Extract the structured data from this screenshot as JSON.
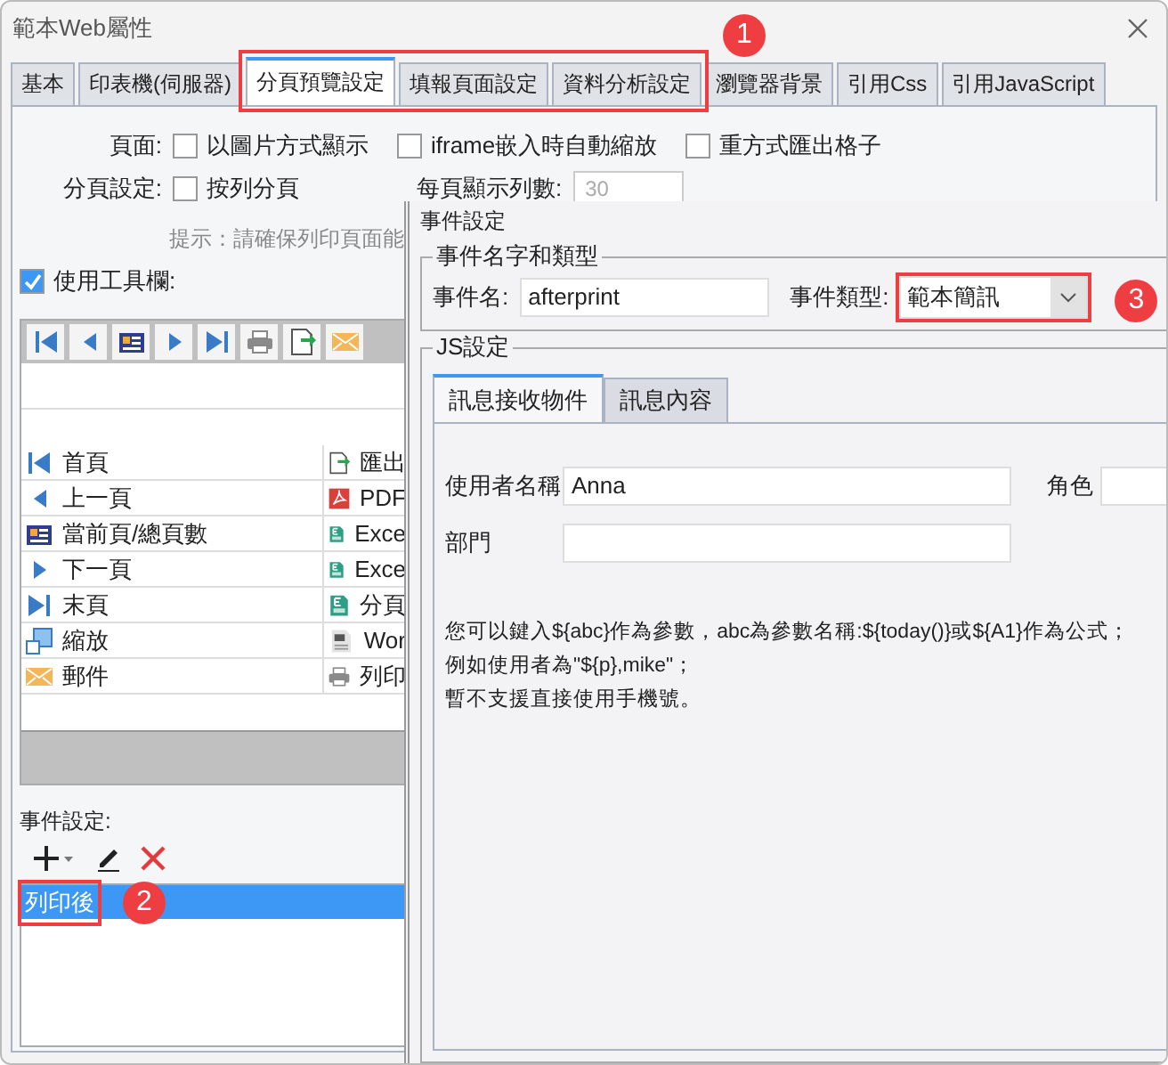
{
  "window": {
    "title": "範本Web屬性"
  },
  "tabs": [
    {
      "label": "基本",
      "selected": false
    },
    {
      "label": "印表機(伺服器)",
      "selected": false
    },
    {
      "label": "分頁預覽設定",
      "selected": true
    },
    {
      "label": "填報頁面設定",
      "selected": false
    },
    {
      "label": "資料分析設定",
      "selected": false
    },
    {
      "label": "瀏覽器背景",
      "selected": false
    },
    {
      "label": "引用Css",
      "selected": false
    },
    {
      "label": "引用JavaScript",
      "selected": false
    }
  ],
  "page_options": {
    "label": "頁面:",
    "checkboxes": [
      {
        "label": "以圖片方式顯示",
        "checked": false
      },
      {
        "label": "iframe嵌入時自動縮放",
        "checked": false
      },
      {
        "label": "重方式匯出格子",
        "checked": false
      }
    ]
  },
  "paging": {
    "label": "分頁設定:",
    "checkbox": {
      "label": "按列分頁",
      "checked": false
    },
    "rows_label": "每頁顯示列數:",
    "rows_value": "30"
  },
  "hint": "提示：請確保列印頁面能",
  "toolbar_option": {
    "label": "使用工具欄:",
    "checked": true
  },
  "toolbar_preview": {
    "buttons": [
      {
        "kind": "first"
      },
      {
        "kind": "prev"
      },
      {
        "kind": "pages"
      },
      {
        "kind": "next"
      },
      {
        "kind": "last"
      },
      {
        "kind": "print"
      },
      {
        "kind": "export"
      },
      {
        "kind": "mail"
      }
    ]
  },
  "toolbar_items": [
    {
      "left": {
        "label": "首頁",
        "kind": "first"
      },
      "right": {
        "label": "匯出",
        "kind": "export"
      }
    },
    {
      "left": {
        "label": "上一頁",
        "kind": "prev"
      },
      "right": {
        "label": "PDF",
        "kind": "pdf"
      }
    },
    {
      "left": {
        "label": "當前頁/總頁數",
        "kind": "pages"
      },
      "right": {
        "label": "Exce",
        "kind": "excel"
      }
    },
    {
      "left": {
        "label": "下一頁",
        "kind": "next"
      },
      "right": {
        "label": "Exce",
        "kind": "excel"
      }
    },
    {
      "left": {
        "label": "末頁",
        "kind": "last"
      },
      "right": {
        "label": "分頁",
        "kind": "excel"
      }
    },
    {
      "left": {
        "label": "縮放",
        "kind": "zoom"
      },
      "right": {
        "label": "Wor",
        "kind": "word"
      }
    },
    {
      "left": {
        "label": "郵件",
        "kind": "mail"
      },
      "right": {
        "label": "列印",
        "kind": "print"
      }
    }
  ],
  "event_settings": {
    "label": "事件設定:",
    "events": [
      {
        "label": "列印後",
        "selected": true
      }
    ]
  },
  "event_dialog": {
    "title": "事件設定",
    "name_group": {
      "legend": "事件名字和類型",
      "name_label": "事件名:",
      "name_value": "afterprint",
      "type_label": "事件類型:",
      "type_value": "範本簡訊"
    },
    "js_group": {
      "legend": "JS設定",
      "tabs": [
        {
          "label": "訊息接收物件",
          "selected": true
        },
        {
          "label": "訊息內容",
          "selected": false
        }
      ],
      "fields": [
        {
          "label": "使用者名稱",
          "value": "Anna"
        },
        {
          "label": "角色"
        },
        {
          "label": "部門"
        }
      ],
      "notes": [
        "您可以鍵入${abc}作為參數，abc為參數名稱:${today()}或${A1}作為公式；",
        "例如使用者為\"${p},mike\"；",
        "暫不支援直接使用手機號。"
      ]
    }
  },
  "annotations": [
    {
      "number": "1"
    },
    {
      "number": "2"
    },
    {
      "number": "3"
    }
  ]
}
